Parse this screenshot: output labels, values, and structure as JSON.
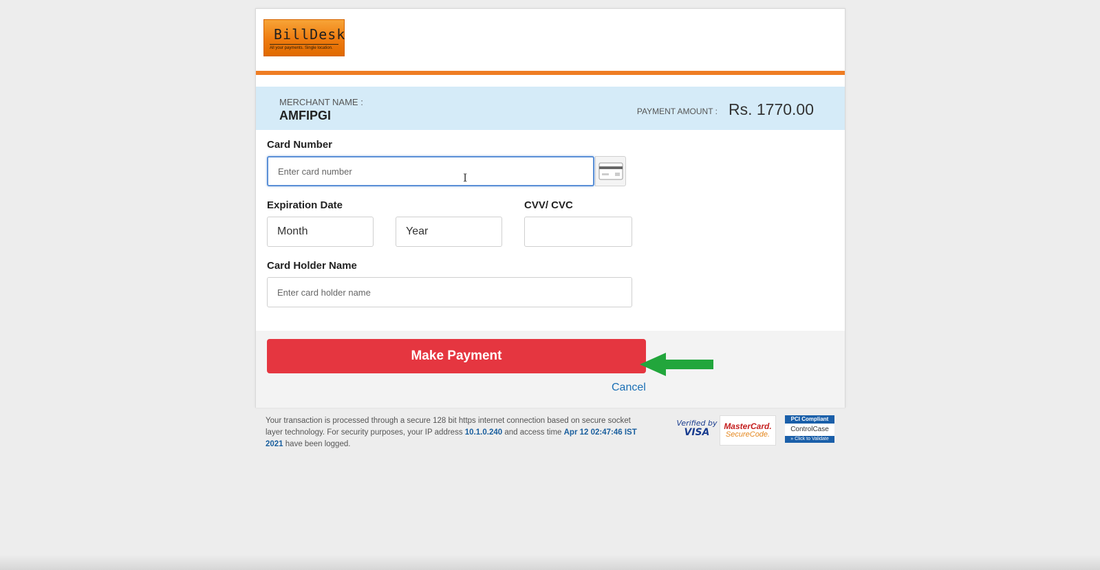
{
  "logo": {
    "name": "BillDesk",
    "tagline": "All your payments. Single location."
  },
  "merchant": {
    "label": "MERCHANT NAME :",
    "name": "AMFIPGI"
  },
  "payment": {
    "amount_label": "PAYMENT AMOUNT :",
    "amount_value": "Rs. 1770.00"
  },
  "form": {
    "card_number_label": "Card Number",
    "card_number_placeholder": "Enter card number",
    "expiration_label": "Expiration Date",
    "month_value": "Month",
    "year_value": "Year",
    "cvv_label": "CVV/ CVC",
    "cvv_value": "",
    "holder_label": "Card Holder Name",
    "holder_placeholder": "Enter card holder name"
  },
  "actions": {
    "make_payment": "Make Payment",
    "cancel": "Cancel"
  },
  "security": {
    "text_part1": "Your transaction is processed through a secure 128 bit https internet connection based on secure socket layer technology. For security purposes, your IP address ",
    "ip": "10.1.0.240",
    "text_part2": " and access time ",
    "time": "Apr 12 02:47:46 IST 2021",
    "text_part3": " have been logged."
  },
  "badges": {
    "visa_line1": "Verified by",
    "visa_line2": "VISA",
    "mc_line1": "MasterCard.",
    "mc_line2": "SecureCode.",
    "pci_top": "PCI Compliant",
    "pci_mid": "ControlCase",
    "pci_bot": "» Click to Validate"
  },
  "colors": {
    "brand_orange": "#ef7d23",
    "band_blue": "#d5ebf8",
    "button_red": "#e53640",
    "link_blue": "#1a6fb5",
    "arrow_green": "#22a63c"
  },
  "icons": {
    "card_type": "credit-card-icon",
    "annotation": "arrow-left-icon",
    "text_cursor": "text-cursor-icon"
  }
}
